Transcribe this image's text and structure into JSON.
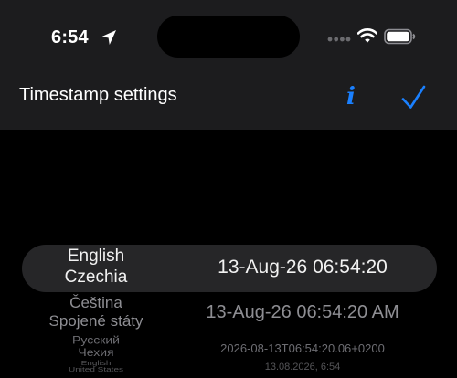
{
  "status_bar": {
    "time": "6:54",
    "icons": [
      "location-arrow-icon",
      "cellular-dots-icon",
      "wifi-icon",
      "battery-icon"
    ]
  },
  "nav": {
    "title": "Timestamp settings",
    "info_icon": "i",
    "done_icon": "checkmark-icon",
    "accent_color": "#1a80ff"
  },
  "picker": {
    "selected_index": 0,
    "rows": [
      {
        "language": "English",
        "region": "Czechia",
        "timestamp": "13-Aug-26 06:54:20"
      },
      {
        "language": "Čeština",
        "region": "Spojené státy",
        "timestamp": "13-Aug-26 06:54:20 AM"
      },
      {
        "language": "Русский",
        "region": "Чехия",
        "timestamp": "2026-08-13T06:54:20.06+0200"
      },
      {
        "language": "English",
        "region": "United States",
        "timestamp": "13.08.2026, 6:54"
      }
    ]
  }
}
